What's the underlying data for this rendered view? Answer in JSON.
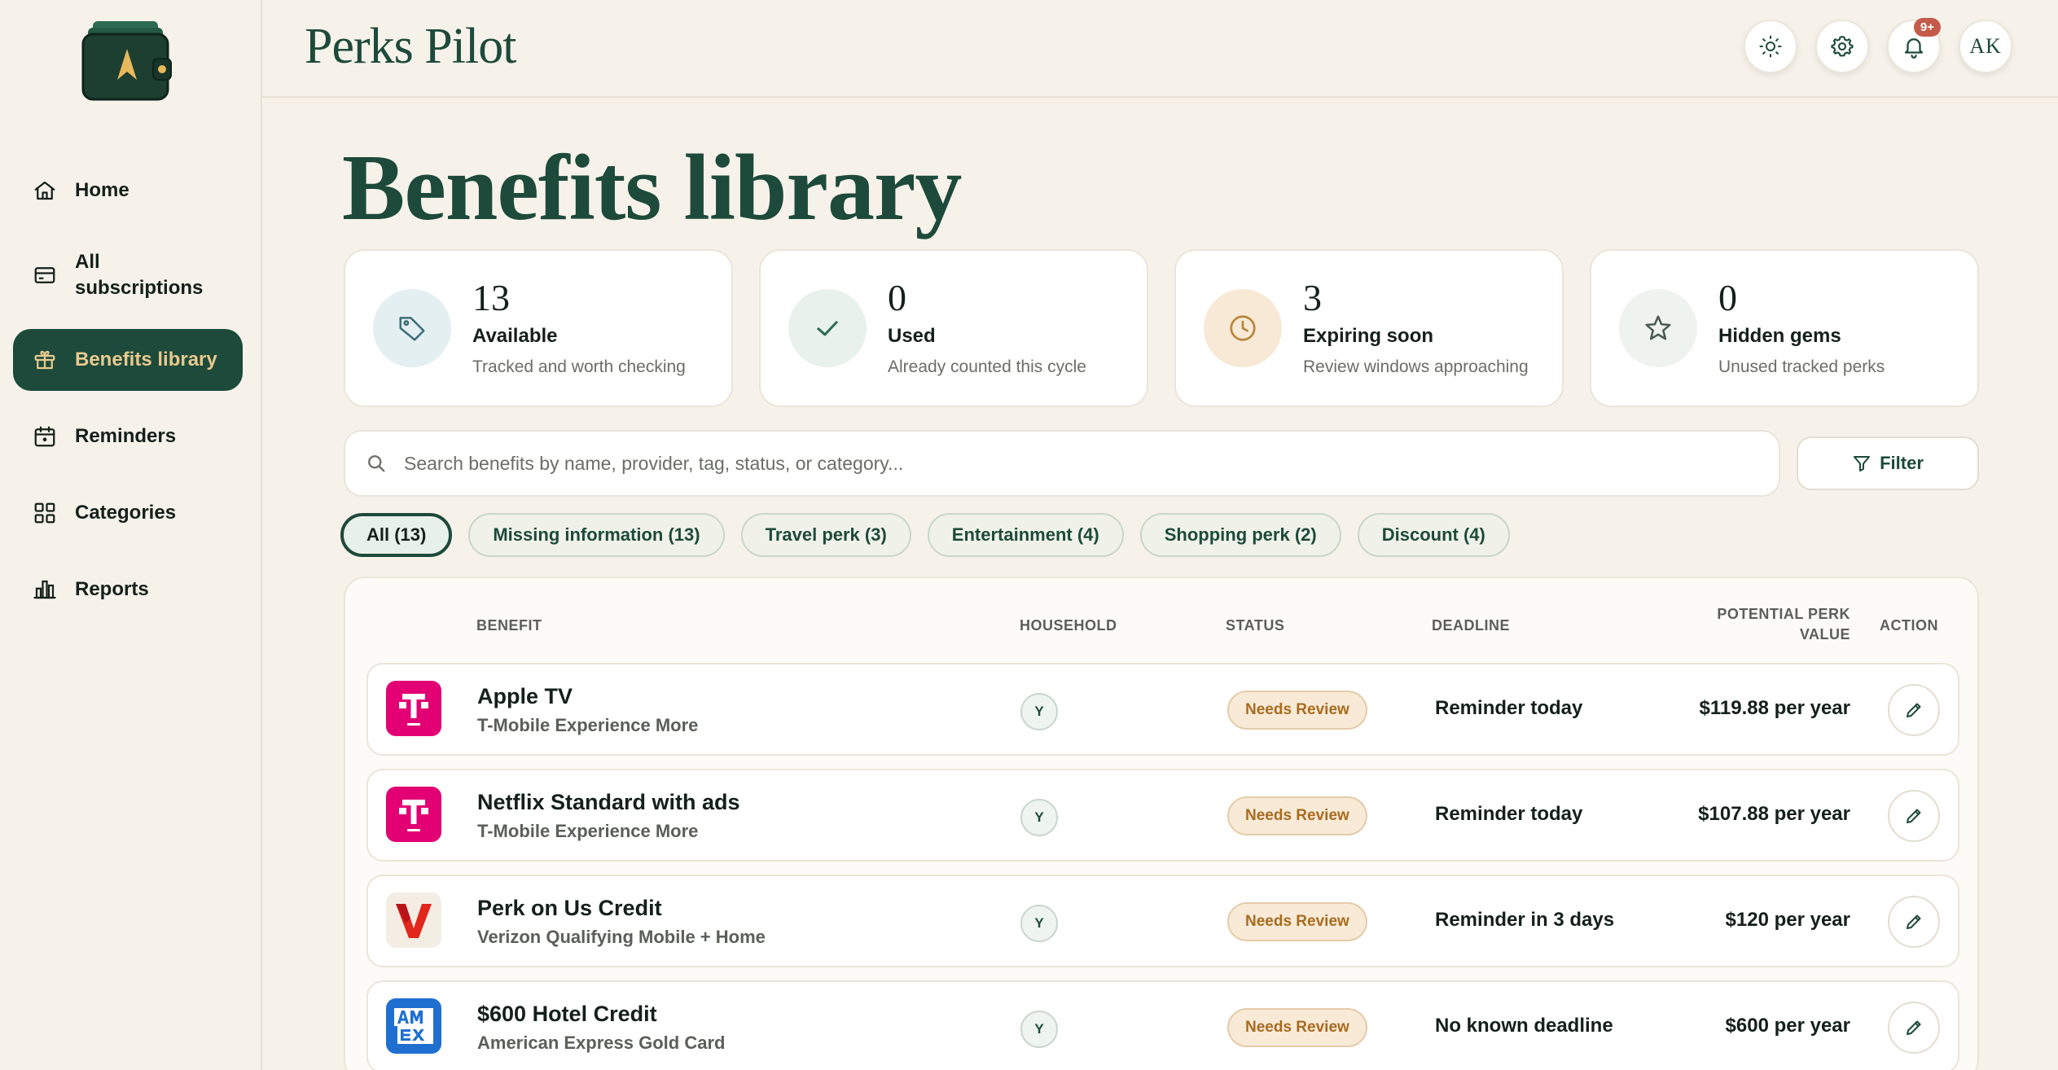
{
  "app": {
    "brand": "Perks Pilot"
  },
  "header": {
    "theme_icon": "sun-icon",
    "settings_icon": "gear-icon",
    "notifications_icon": "bell-icon",
    "notifications_badge": "9+",
    "avatar_initials": "AK"
  },
  "sidebar": {
    "items": [
      {
        "label": "Home",
        "icon": "home-icon"
      },
      {
        "label": "All subscriptions",
        "icon": "card-icon"
      },
      {
        "label": "Benefits library",
        "icon": "gift-icon",
        "active": true
      },
      {
        "label": "Reminders",
        "icon": "calendar-icon"
      },
      {
        "label": "Categories",
        "icon": "grid-icon"
      },
      {
        "label": "Reports",
        "icon": "bar-chart-icon"
      }
    ]
  },
  "page": {
    "title": "Benefits library"
  },
  "stats": [
    {
      "number": "13",
      "label": "Available",
      "sub": "Tracked and worth checking",
      "icon": "tag-icon"
    },
    {
      "number": "0",
      "label": "Used",
      "sub": "Already counted this cycle",
      "icon": "check-icon"
    },
    {
      "number": "3",
      "label": "Expiring soon",
      "sub": "Review windows approaching",
      "icon": "clock-icon"
    },
    {
      "number": "0",
      "label": "Hidden gems",
      "sub": "Unused tracked perks",
      "icon": "star-icon"
    }
  ],
  "search": {
    "placeholder": "Search benefits by name, provider, tag, status, or category...",
    "value": ""
  },
  "filter": {
    "label": "Filter"
  },
  "chips": [
    {
      "label": "All (13)",
      "active": true
    },
    {
      "label": "Missing information (13)"
    },
    {
      "label": "Travel perk (3)"
    },
    {
      "label": "Entertainment (4)"
    },
    {
      "label": "Shopping perk (2)"
    },
    {
      "label": "Discount (4)"
    }
  ],
  "table": {
    "headers": {
      "benefit": "BENEFIT",
      "household": "HOUSEHOLD",
      "status": "STATUS",
      "deadline": "DEADLINE",
      "value_line1": "POTENTIAL PERK",
      "value_line2": "VALUE",
      "action": "ACTION"
    },
    "rows": [
      {
        "name": "Apple TV",
        "provider": "T-Mobile Experience More",
        "household": "Y",
        "status": "Needs Review",
        "deadline": "Reminder today",
        "value": "$119.88 per year",
        "logo": "t-life-logo"
      },
      {
        "name": "Netflix Standard with ads",
        "provider": "T-Mobile Experience More",
        "household": "Y",
        "status": "Needs Review",
        "deadline": "Reminder today",
        "value": "$107.88 per year",
        "logo": "t-life-logo"
      },
      {
        "name": "Perk on Us Credit",
        "provider": "Verizon Qualifying Mobile + Home",
        "household": "Y",
        "status": "Needs Review",
        "deadline": "Reminder in 3 days",
        "value": "$120 per year",
        "logo": "verizon-logo"
      },
      {
        "name": "$600 Hotel Credit",
        "provider": "American Express Gold Card",
        "household": "Y",
        "status": "Needs Review",
        "deadline": "No known deadline",
        "value": "$600 per year",
        "logo": "amex-logo"
      }
    ]
  },
  "colors": {
    "primary": "#1d4a3a",
    "accent_gold": "#e8c98f",
    "background": "#f6f2ea",
    "status_warning": "#a86b1f",
    "tmobile": "#e20074",
    "verizon": "#e1261c",
    "amex": "#1f6fd1"
  }
}
